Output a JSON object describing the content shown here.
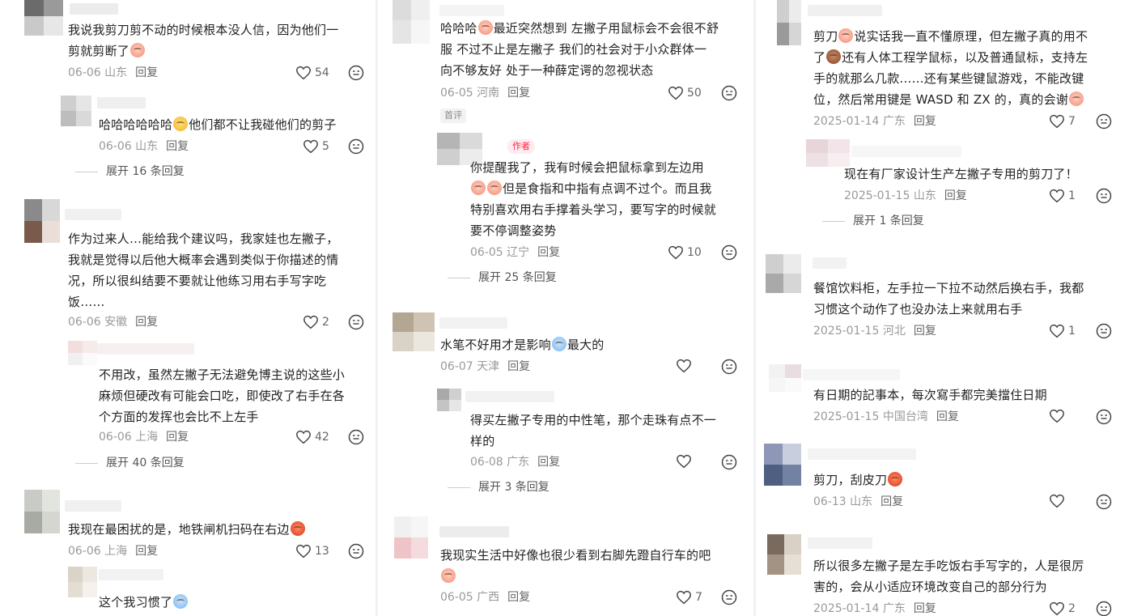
{
  "columns": [
    {
      "comments": [
        {
          "id": "c1",
          "text_lines": [
            "我说我剪刀剪不动的时候根本没人信，因为他们一",
            "剪就剪断了"
          ],
          "emoji_tail": "pink",
          "date": "06-06",
          "region": "山东",
          "reply_label": "回复",
          "likes": "54",
          "avatar_colors": [
            "#6b6b6b",
            "#9a9a9a",
            "#c9c9c9",
            "#e7e7e7"
          ]
        },
        {
          "id": "c1r1",
          "text_lines": [
            "哈哈哈哈哈哈",
            "他们都不让我碰他们的剪子"
          ],
          "emoji_mid": "cool",
          "date": "06-06",
          "region": "山东",
          "reply_label": "回复",
          "likes": "5",
          "avatar_colors": [
            "#cfcfcf",
            "#e6e6e6",
            "#bdbdbd",
            "#d9d9d9"
          ]
        },
        {
          "id": "c1exp",
          "expand_label": "展开 16 条回复"
        },
        {
          "id": "c2",
          "text_lines": [
            "作为过来人…能给我个建议吗，我家娃也左撇子，",
            "我就是觉得以后他大概率会遇到类似于你描述的情",
            "况，所以很纠结要不要就让他练习用右手写字吃",
            "饭……"
          ],
          "date": "06-06",
          "region": "安徽",
          "reply_label": "回复",
          "likes": "2",
          "avatar_colors": [
            "#8a8a8a",
            "#d8d8d8",
            "#7a5a4a",
            "#eadfd8"
          ]
        },
        {
          "id": "c2r1",
          "text_lines": [
            "不用改，虽然左撇子无法避免博主说的这些小",
            "麻烦但硬改有可能会口吃，即使改了右手在各",
            "个方面的发挥也会比不上左手"
          ],
          "date": "06-06",
          "region": "上海",
          "reply_label": "回复",
          "likes": "42",
          "avatar_colors": [
            "#f3dede",
            "#f7eaea",
            "#f0f0f0",
            "#fafafa"
          ]
        },
        {
          "id": "c2exp",
          "expand_label": "展开 40 条回复"
        },
        {
          "id": "c3",
          "text_lines": [
            "我现在最困扰的是，地铁闸机扫码在右边"
          ],
          "emoji_tail": "red",
          "date": "06-06",
          "region": "上海",
          "reply_label": "回复",
          "likes": "13",
          "avatar_colors": [
            "#c9ccc6",
            "#e2e4de",
            "#a8aba4",
            "#d4d6cf"
          ]
        },
        {
          "id": "c3r1",
          "text_lines": [
            "这个我习惯了"
          ],
          "emoji_tail": "blue"
        }
      ]
    },
    {
      "comments": [
        {
          "id": "m1",
          "text_lines": [
            "哈哈哈",
            "最近突然想到 左撇子用鼠标会不会很不舒",
            "服  不过不止是左撇子 我们的社会对于小众群体一",
            "向不够友好 处于一种薛定谔的忽视状态"
          ],
          "emoji_mid": "pink",
          "date": "06-05",
          "region": "河南",
          "reply_label": "回复",
          "likes": "50",
          "tag": "首评",
          "avatar_colors": [
            "#dcdcdc",
            "#efefef",
            "#e5e5e5",
            "#f6f6f6"
          ]
        },
        {
          "id": "m1r1",
          "author_badge": "作者",
          "text_lines": [
            "你提醒我了，我有时候会把鼠标拿到左边用",
            "但是食指和中指有点调不过个。而且我",
            "特别喜欢用右手撑着头学习，要写字的时候就",
            "要不停调整姿势"
          ],
          "date": "06-05",
          "region": "辽宁",
          "reply_label": "回复",
          "likes": "10",
          "avatar_colors": [
            "#b5b5b5",
            "#dadada",
            "#cfcfcf",
            "#ececec"
          ]
        },
        {
          "id": "m1exp",
          "expand_label": "展开 25 条回复"
        },
        {
          "id": "m2",
          "text_lines": [
            "水笔不好用才是影响",
            "最大的"
          ],
          "emoji_mid": "blue",
          "date": "06-07",
          "region": "天津",
          "reply_label": "回复",
          "likes": "",
          "avatar_colors": [
            "#b3a693",
            "#cfc4b4",
            "#d9d2c6",
            "#ece7de"
          ]
        },
        {
          "id": "m2r1",
          "text_lines": [
            "得买左撇子专用的中性笔，那个走珠有点不一",
            "样的"
          ],
          "date": "06-08",
          "region": "广东",
          "reply_label": "回复",
          "likes": "",
          "avatar_colors": [
            "#a9a9a9",
            "#d0d0d0",
            "#c4c4c4",
            "#e6e6e6"
          ]
        },
        {
          "id": "m2exp",
          "expand_label": "展开 3 条回复"
        },
        {
          "id": "m3",
          "text_lines": [
            "我现实生活中好像也很少看到右脚先蹬自行车的吧",
            ""
          ],
          "emoji_tail": "pink",
          "date": "06-05",
          "region": "广西",
          "reply_label": "回复",
          "likes": "7",
          "avatar_colors": [
            "#f0f0f0",
            "#f6f6f6",
            "#eec4c8",
            "#f4dcde"
          ]
        }
      ]
    },
    {
      "comments": [
        {
          "id": "r1",
          "text_lines": [
            "剪刀",
            "说实话我一直不懂原理，但左撇子真的用不",
            "了",
            "还有人体工程学鼠标，以及普通鼠标，支持左",
            "手的就那么几款……还有某些键鼠游戏，不能改键",
            "位，然后常用键是 WASD 和 ZX 的，真的会谢"
          ],
          "date": "2025-01-14",
          "region": "广东",
          "reply_label": "回复",
          "likes": "7",
          "avatar_colors": [
            "#cfcfcf",
            "#ececec",
            "#9a9a9a",
            "#d6d6d6"
          ]
        },
        {
          "id": "r1r1",
          "text_lines": [
            "现在有厂家设计生产左撇子专用的剪刀了！"
          ],
          "date": "2025-01-15",
          "region": "山东",
          "reply_label": "回复",
          "likes": "1",
          "avatar_colors": [
            "#e8d5da",
            "#f2e4e8",
            "#ede1e4",
            "#f7eef0"
          ]
        },
        {
          "id": "r1exp",
          "expand_label": "展开 1 条回复"
        },
        {
          "id": "r2",
          "text_lines": [
            "餐馆饮料柜，左手拉一下拉不动然后换右手，我都",
            "习惯这个动作了也没办法上来就用右手"
          ],
          "date": "2025-01-15",
          "region": "河北",
          "reply_label": "回复",
          "likes": "1",
          "avatar_colors": [
            "#cfcfcf",
            "#ebebeb",
            "#a9a9a9",
            "#d6d6d6"
          ]
        },
        {
          "id": "r3",
          "text_lines": [
            "有日期的記事本，每次寫手都完美擋住日期"
          ],
          "date": "2025-01-15",
          "region": "中国台湾",
          "reply_label": "回复",
          "likes": "",
          "avatar_colors": [
            "#f2f2f2",
            "#eadde1",
            "#f6f6f6",
            "#fafafa"
          ]
        },
        {
          "id": "r4",
          "text_lines": [
            "剪刀，刮皮刀"
          ],
          "emoji_tail": "red",
          "date": "06-13",
          "region": "山东",
          "reply_label": "回复",
          "likes": "",
          "avatar_colors": [
            "#8e97b5",
            "#c8cede",
            "#4e5f82",
            "#7382a3"
          ]
        },
        {
          "id": "r5",
          "text_lines": [
            "所以很多左撇子是左手吃饭右手写字的，人是很厉",
            "害的，会从小适应环境改变自己的部分行为"
          ],
          "date": "2025-01-14",
          "region": "广东",
          "reply_label": "回复",
          "likes": "2",
          "avatar_colors": [
            "#7a6a5e",
            "#d9d0c6",
            "#a39384",
            "#e6dfd6"
          ]
        }
      ]
    }
  ]
}
